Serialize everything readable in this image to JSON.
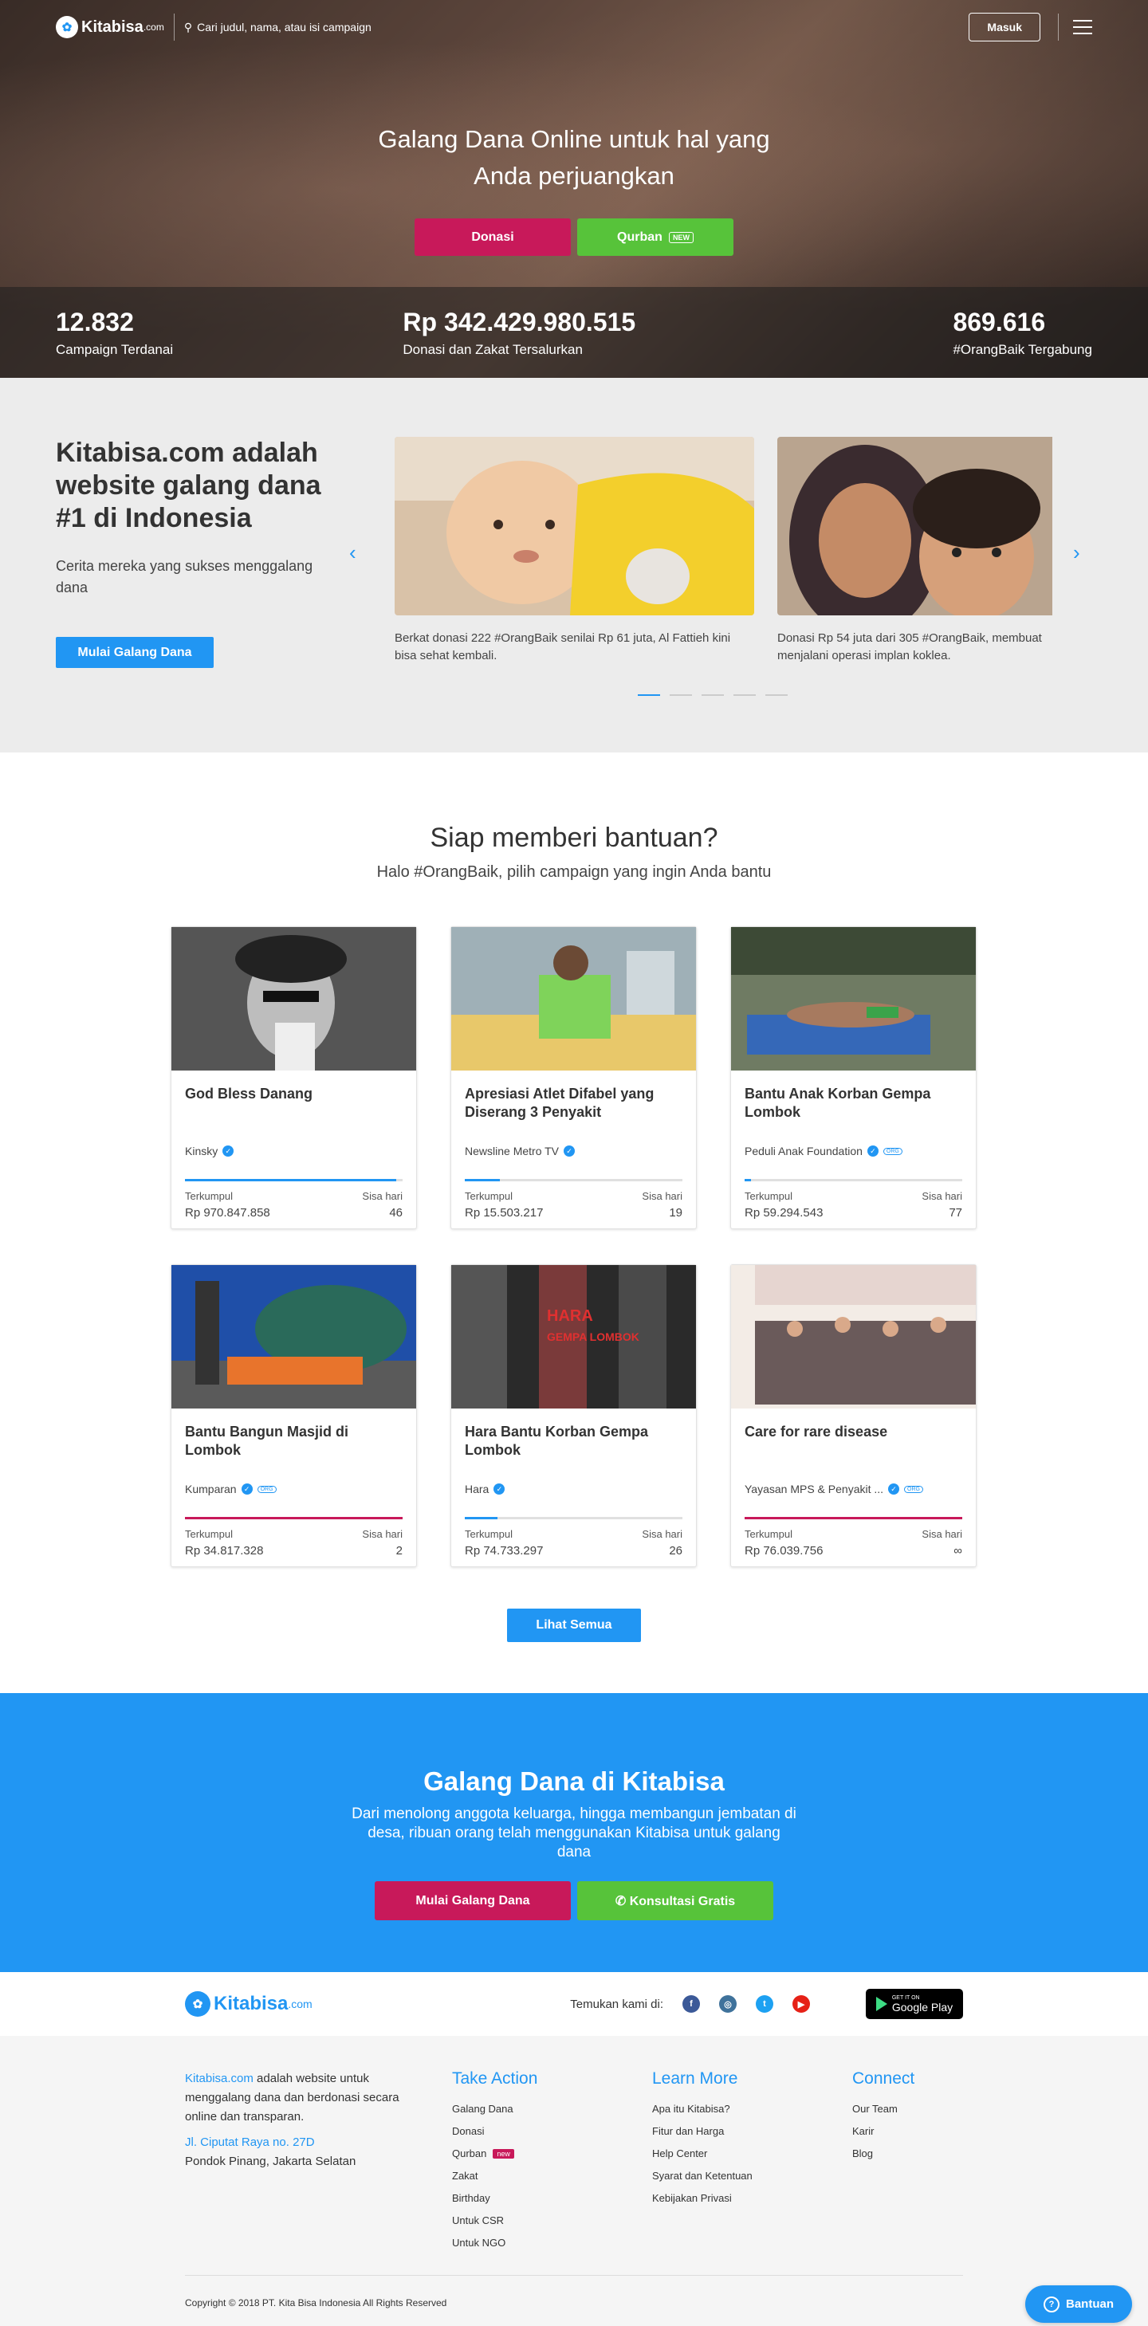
{
  "header": {
    "logo": "Kitabisa",
    "logo_suffix": ".com",
    "search_placeholder": "Cari judul, nama, atau isi campaign",
    "login": "Masuk"
  },
  "hero": {
    "title_line1": "Galang Dana Online untuk hal yang",
    "title_line2": "Anda perjuangkan",
    "donasi": "Donasi",
    "qurban": "Qurban",
    "new": "NEW"
  },
  "stats": [
    {
      "value": "12.832",
      "label": "Campaign Terdanai"
    },
    {
      "value": "Rp 342.429.980.515",
      "label": "Donasi dan Zakat Tersalurkan"
    },
    {
      "value": "869.616",
      "label": "#OrangBaik Tergabung"
    }
  ],
  "story": {
    "title": "Kitabisa.com adalah website galang dana #1 di Indonesia",
    "subtitle": "Cerita mereka yang sukses menggalang dana",
    "cta": "Mulai Galang Dana",
    "slides": [
      {
        "caption": "Berkat donasi 222 #OrangBaik senilai Rp 61 juta, Al Fattieh kini bisa sehat kembali."
      },
      {
        "caption": "Donasi Rp 54 juta dari 305 #OrangBaik, membuat menjalani operasi implan koklea."
      }
    ]
  },
  "campaigns": {
    "title": "Siap memberi bantuan?",
    "subtitle": "Halo #OrangBaik, pilih campaign yang ingin Anda bantu",
    "collected_label": "Terkumpul",
    "days_label": "Sisa hari",
    "see_all": "Lihat Semua",
    "org_badge": "ORG",
    "items": [
      {
        "title": "God Bless Danang",
        "org": "Kinsky",
        "org_badge": false,
        "amount": "Rp 970.847.858",
        "days": "46",
        "progress": 0.97,
        "color": "#2196f3"
      },
      {
        "title": "Apresiasi Atlet Difabel yang Diserang 3 Penyakit",
        "org": "Newsline Metro TV",
        "org_badge": false,
        "amount": "Rp 15.503.217",
        "days": "19",
        "progress": 0.16,
        "color": "#2196f3"
      },
      {
        "title": "Bantu Anak Korban Gempa Lombok",
        "org": "Peduli Anak Foundation",
        "org_badge": true,
        "amount": "Rp 59.294.543",
        "days": "77",
        "progress": 0.03,
        "color": "#2196f3"
      },
      {
        "title": "Bantu Bangun Masjid di Lombok",
        "org": "Kumparan",
        "org_badge": true,
        "amount": "Rp 34.817.328",
        "days": "2",
        "progress": 1,
        "color": "#c8195a"
      },
      {
        "title": "Hara Bantu Korban Gempa Lombok",
        "org": "Hara",
        "org_badge": false,
        "amount": "Rp 74.733.297",
        "days": "26",
        "progress": 0.15,
        "color": "#2196f3"
      },
      {
        "title": "Care for rare disease",
        "org": "Yayasan MPS & Penyakit ...",
        "org_badge": true,
        "amount": "Rp 76.039.756",
        "days": "∞",
        "progress": 1,
        "color": "#c8195a"
      }
    ]
  },
  "cta": {
    "title": "Galang Dana di Kitabisa",
    "text": "Dari menolong anggota keluarga, hingga membangun jembatan di desa, ribuan orang telah menggunakan Kitabisa untuk galang dana",
    "start": "Mulai Galang Dana",
    "consult": "Konsultasi Gratis"
  },
  "social": {
    "label": "Temukan kami di:",
    "gplay_small": "GET IT ON",
    "gplay": "Google Play"
  },
  "footer": {
    "about_link": "Kitabisa.com",
    "about_text": " adalah website untuk menggalang dana dan berdonasi secara online dan transparan.",
    "address_link": "Jl. Ciputat Raya no. 27D",
    "address": "Pondok Pinang, Jakarta Selatan",
    "take_action": {
      "title": "Take Action",
      "items": [
        "Galang Dana",
        "Donasi",
        "Qurban",
        "Zakat",
        "Birthday",
        "Untuk CSR",
        "Untuk NGO"
      ],
      "new": "new"
    },
    "learn_more": {
      "title": "Learn More",
      "items": [
        "Apa itu Kitabisa?",
        "Fitur dan Harga",
        "Help Center",
        "Syarat dan Ketentuan",
        "Kebijakan Privasi"
      ]
    },
    "connect": {
      "title": "Connect",
      "items": [
        "Our Team",
        "Karir",
        "Blog"
      ]
    },
    "copyright": "Copyright © 2018 PT. Kita Bisa Indonesia All Rights Reserved",
    "help": "Bantuan"
  },
  "colors": {
    "brand": "#2196f3",
    "red": "#c8195a",
    "green": "#57c33a"
  }
}
